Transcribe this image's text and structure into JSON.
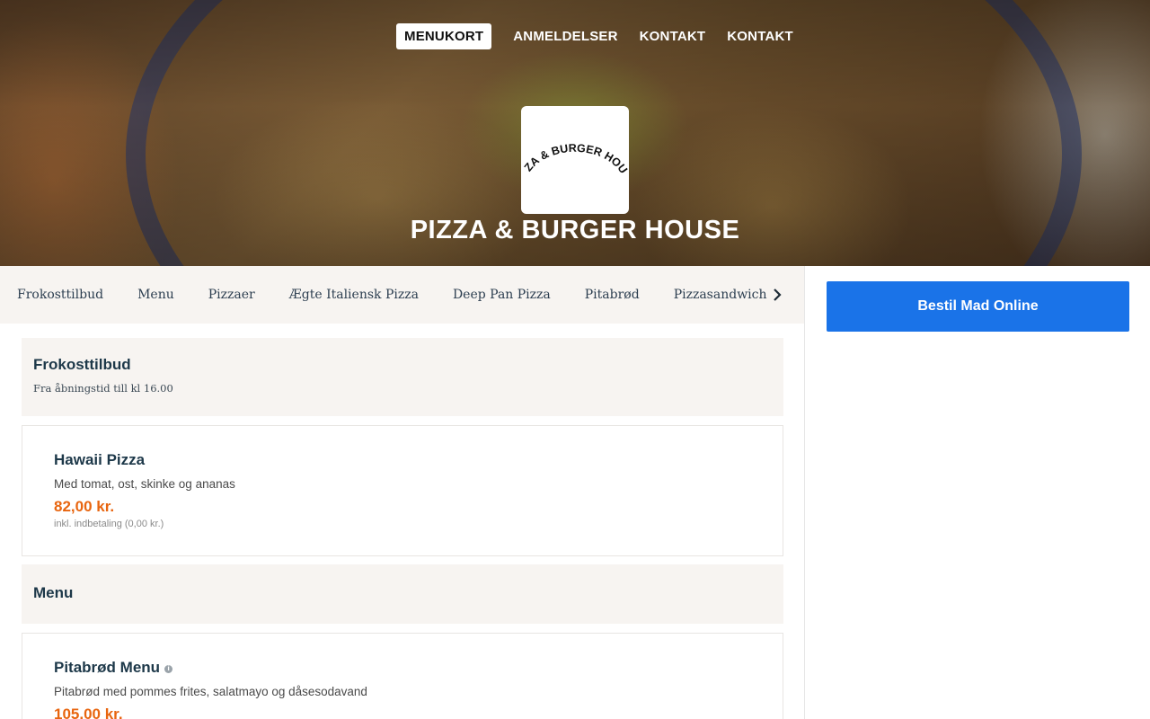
{
  "nav": {
    "items": [
      {
        "label": "MENUKORT",
        "active": true
      },
      {
        "label": "ANMELDELSER",
        "active": false
      },
      {
        "label": "KONTAKT",
        "active": false
      },
      {
        "label": "KONTAKT",
        "active": false
      }
    ]
  },
  "restaurant": {
    "name": "PIZZA & BURGER HOUSE",
    "logo_text": "PIZZA & BURGER HOUSE"
  },
  "categories": {
    "items": [
      "Frokosttilbud",
      "Menu",
      "Pizzaer",
      "Ægte Italiensk Pizza",
      "Deep Pan Pizza",
      "Pitabrød",
      "Pizzasandwich"
    ],
    "scroll_icon": "chevron-right-icon"
  },
  "order": {
    "button_label": "Bestil Mad Online",
    "button_color": "#1a73e8"
  },
  "sections": [
    {
      "title": "Frokosttilbud",
      "subtitle": "Fra åbningstid till kl 16.00",
      "products": [
        {
          "name": "Hawaii Pizza",
          "description": "Med tomat, ost, skinke og ananas",
          "price": "82,00 kr.",
          "deposit": "inkl. indbetaling (0,00 kr.)"
        }
      ]
    },
    {
      "title": "Menu",
      "subtitle": "",
      "products": [
        {
          "name": "Pitabrød Menu",
          "info_icon": "info-icon",
          "description": "Pitabrød med pommes frites, salatmayo og dåsesodavand",
          "price": "105,00 kr."
        }
      ]
    }
  ],
  "colors": {
    "price": "#e8650f",
    "heading": "#1d3849",
    "section_bg": "#f7f4f1"
  }
}
